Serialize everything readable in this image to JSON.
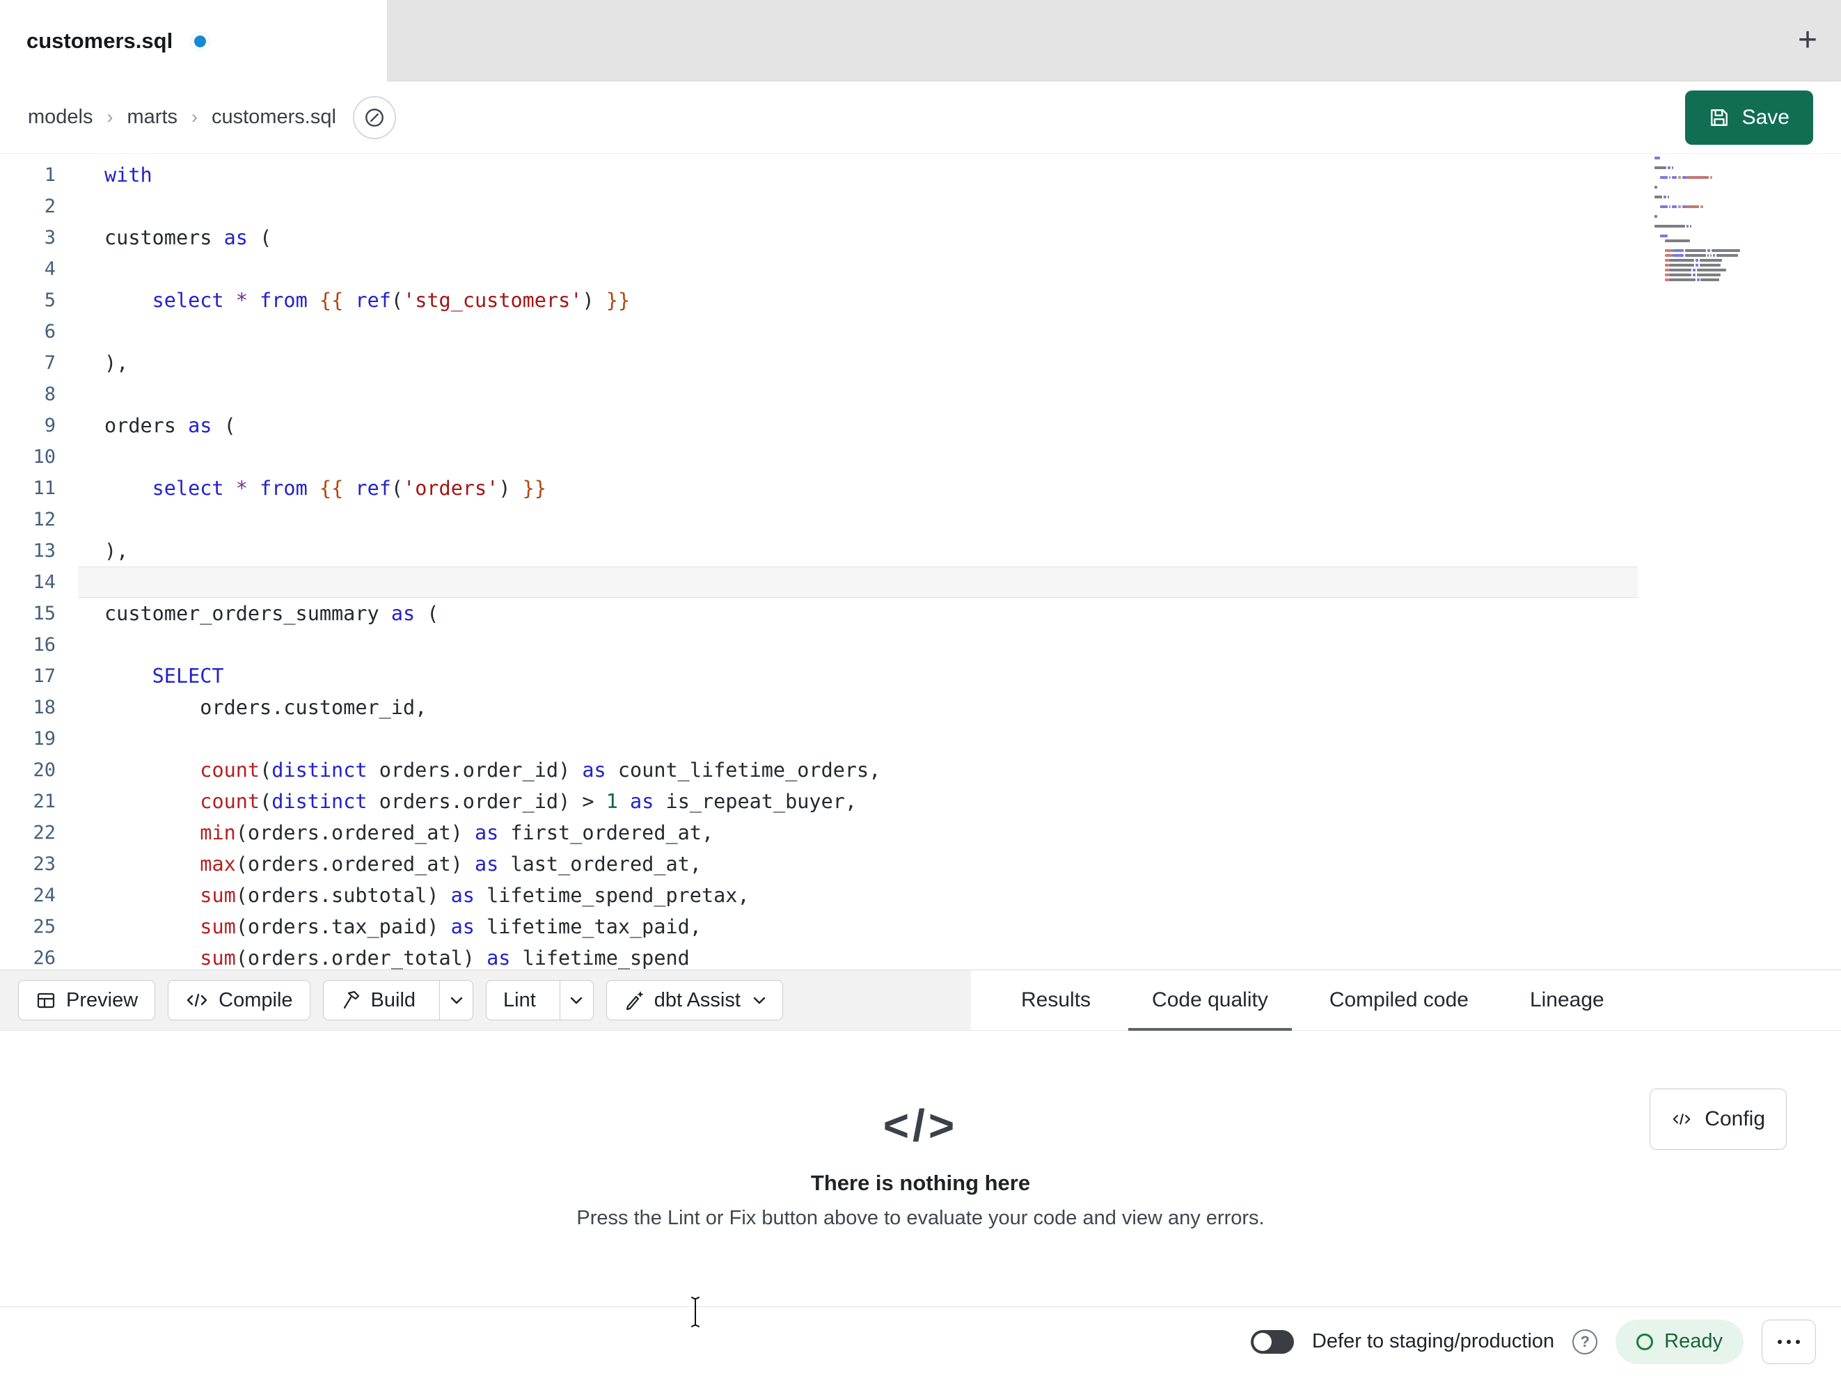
{
  "colors": {
    "accent": "#116e52",
    "unsaved": "#1589d6",
    "ready": "#188038",
    "kw": "#2222cc",
    "fn": "#b22222",
    "str": "#a31515",
    "jinja": "#b34711",
    "num": "#116644",
    "star": "#7a2e8e",
    "plain": "#24292e"
  },
  "tab_bar": {
    "active_tab": "customers.sql",
    "new_tab_label": "+"
  },
  "breadcrumb": {
    "items": [
      "models",
      "marts",
      "customers.sql"
    ],
    "separator": "›"
  },
  "save_button": {
    "label": "Save"
  },
  "editor": {
    "lines": [
      {
        "n": 1,
        "tokens": [
          [
            "kw",
            "with"
          ]
        ]
      },
      {
        "n": 2,
        "tokens": []
      },
      {
        "n": 3,
        "tokens": [
          [
            "plain",
            "customers "
          ],
          [
            "kw",
            "as"
          ],
          [
            "plain",
            " ("
          ]
        ]
      },
      {
        "n": 4,
        "tokens": []
      },
      {
        "n": 5,
        "tokens": [
          [
            "plain",
            "    "
          ],
          [
            "kw",
            "select"
          ],
          [
            "plain",
            " "
          ],
          [
            "star",
            "*"
          ],
          [
            "plain",
            " "
          ],
          [
            "kw",
            "from"
          ],
          [
            "plain",
            " "
          ],
          [
            "jinja",
            "{{ "
          ],
          [
            "kw",
            "ref"
          ],
          [
            "plain",
            "("
          ],
          [
            "str",
            "'stg_customers'"
          ],
          [
            "plain",
            ")"
          ],
          [
            "jinja",
            " }}"
          ]
        ]
      },
      {
        "n": 6,
        "tokens": []
      },
      {
        "n": 7,
        "tokens": [
          [
            "plain",
            "),"
          ]
        ]
      },
      {
        "n": 8,
        "tokens": []
      },
      {
        "n": 9,
        "tokens": [
          [
            "plain",
            "orders "
          ],
          [
            "kw",
            "as"
          ],
          [
            "plain",
            " ("
          ]
        ]
      },
      {
        "n": 10,
        "tokens": []
      },
      {
        "n": 11,
        "tokens": [
          [
            "plain",
            "    "
          ],
          [
            "kw",
            "select"
          ],
          [
            "plain",
            " "
          ],
          [
            "star",
            "*"
          ],
          [
            "plain",
            " "
          ],
          [
            "kw",
            "from"
          ],
          [
            "plain",
            " "
          ],
          [
            "jinja",
            "{{ "
          ],
          [
            "kw",
            "ref"
          ],
          [
            "plain",
            "("
          ],
          [
            "str",
            "'orders'"
          ],
          [
            "plain",
            ")"
          ],
          [
            "jinja",
            " }}"
          ]
        ]
      },
      {
        "n": 12,
        "tokens": []
      },
      {
        "n": 13,
        "tokens": [
          [
            "plain",
            "),"
          ]
        ]
      },
      {
        "n": 14,
        "tokens": [],
        "active": true
      },
      {
        "n": 15,
        "tokens": [
          [
            "plain",
            "customer_orders_summary "
          ],
          [
            "kw",
            "as"
          ],
          [
            "plain",
            " ("
          ]
        ]
      },
      {
        "n": 16,
        "tokens": []
      },
      {
        "n": 17,
        "tokens": [
          [
            "plain",
            "    "
          ],
          [
            "kw",
            "SELECT"
          ]
        ]
      },
      {
        "n": 18,
        "tokens": [
          [
            "plain",
            "        orders.customer_id,"
          ]
        ]
      },
      {
        "n": 19,
        "tokens": []
      },
      {
        "n": 20,
        "tokens": [
          [
            "plain",
            "        "
          ],
          [
            "fn",
            "count"
          ],
          [
            "plain",
            "("
          ],
          [
            "kw",
            "distinct"
          ],
          [
            "plain",
            " orders.order_id) "
          ],
          [
            "kw",
            "as"
          ],
          [
            "plain",
            " count_lifetime_orders,"
          ]
        ]
      },
      {
        "n": 21,
        "tokens": [
          [
            "plain",
            "        "
          ],
          [
            "fn",
            "count"
          ],
          [
            "plain",
            "("
          ],
          [
            "kw",
            "distinct"
          ],
          [
            "plain",
            " orders.order_id) > "
          ],
          [
            "num",
            "1"
          ],
          [
            "plain",
            " "
          ],
          [
            "kw",
            "as"
          ],
          [
            "plain",
            " is_repeat_buyer,"
          ]
        ]
      },
      {
        "n": 22,
        "tokens": [
          [
            "plain",
            "        "
          ],
          [
            "fn",
            "min"
          ],
          [
            "plain",
            "(orders.ordered_at) "
          ],
          [
            "kw",
            "as"
          ],
          [
            "plain",
            " first_ordered_at,"
          ]
        ]
      },
      {
        "n": 23,
        "tokens": [
          [
            "plain",
            "        "
          ],
          [
            "fn",
            "max"
          ],
          [
            "plain",
            "(orders.ordered_at) "
          ],
          [
            "kw",
            "as"
          ],
          [
            "plain",
            " last_ordered_at,"
          ]
        ]
      },
      {
        "n": 24,
        "tokens": [
          [
            "plain",
            "        "
          ],
          [
            "fn",
            "sum"
          ],
          [
            "plain",
            "(orders.subtotal) "
          ],
          [
            "kw",
            "as"
          ],
          [
            "plain",
            " lifetime_spend_pretax,"
          ]
        ]
      },
      {
        "n": 25,
        "tokens": [
          [
            "plain",
            "        "
          ],
          [
            "fn",
            "sum"
          ],
          [
            "plain",
            "(orders.tax_paid) "
          ],
          [
            "kw",
            "as"
          ],
          [
            "plain",
            " lifetime_tax_paid,"
          ]
        ]
      },
      {
        "n": 26,
        "tokens": [
          [
            "plain",
            "        "
          ],
          [
            "fn",
            "sum"
          ],
          [
            "plain",
            "(orders.order_total) "
          ],
          [
            "kw",
            "as"
          ],
          [
            "plain",
            " lifetime_spend"
          ]
        ]
      }
    ]
  },
  "toolbar": {
    "preview_label": "Preview",
    "compile_label": "Compile",
    "build_label": "Build",
    "lint_label": "Lint",
    "dbt_assist_label": "dbt Assist"
  },
  "panel_tabs": [
    {
      "label": "Results",
      "active": false
    },
    {
      "label": "Code quality",
      "active": true
    },
    {
      "label": "Compiled code",
      "active": false
    },
    {
      "label": "Lineage",
      "active": false
    }
  ],
  "empty_state": {
    "icon": "</>",
    "title": "There is nothing here",
    "subtitle": "Press the Lint or Fix button above to evaluate your code and view any errors.",
    "config_label": "Config"
  },
  "status_bar": {
    "defer_label": "Defer to staging/production",
    "ready_label": "Ready"
  }
}
